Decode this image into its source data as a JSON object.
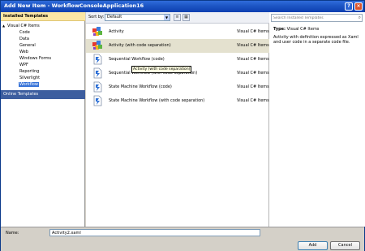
{
  "window": {
    "title": "Add New Item - WorkflowConsoleApplication16",
    "help_glyph": "?",
    "close_glyph": "×"
  },
  "left": {
    "installed_header": "Installed Templates",
    "root_label": "Visual C# Items",
    "root_toggle": "▲",
    "tree_items": [
      "Code",
      "Data",
      "General",
      "Web",
      "Windows Forms",
      "WPF",
      "Reporting",
      "Silverlight",
      "Workflow"
    ],
    "selected_item": "Workflow",
    "online_header": "Online Templates"
  },
  "sortbar": {
    "label": "Sort by:",
    "value": "Default"
  },
  "items": [
    {
      "name": "Activity",
      "type": "Visual C# Items",
      "icon": "activity-icon"
    },
    {
      "name": "Activity (with code separation)",
      "type": "Visual C# Items",
      "icon": "activity-icon"
    },
    {
      "name": "Sequential Workflow (code)",
      "type": "Visual C# Items",
      "icon": "workflow-icon"
    },
    {
      "name": "Sequential Workflow (with code separation)",
      "type": "Visual C# Items",
      "icon": "workflow-icon"
    },
    {
      "name": "State Machine Workflow (code)",
      "type": "Visual C# Items",
      "icon": "workflow-icon"
    },
    {
      "name": "State Machine Workflow (with code separation)",
      "type": "Visual C# Items",
      "icon": "workflow-icon"
    }
  ],
  "tooltip": "Activity (with code separation)",
  "right": {
    "search_placeholder": "Search Installed Templates",
    "type_label": "Type:",
    "type_value": "Visual C# Items",
    "description": "Activity with definition expressed as Xaml and user code in a separate code file."
  },
  "bottom": {
    "name_label": "Name:",
    "name_value": "Activity2.xaml",
    "add_label": "Add",
    "cancel_label": "Cancel"
  },
  "colors": {
    "title_bar": "#1d55c4",
    "installed_header": "#fce7a5",
    "online_header": "#3d5e9f",
    "selected_row": "#e4e1cf",
    "selected_tree_item": "#3874d8"
  }
}
